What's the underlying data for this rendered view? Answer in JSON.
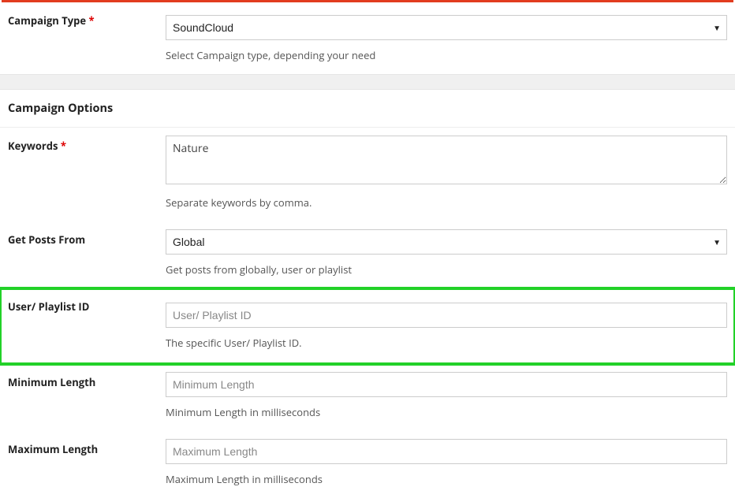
{
  "campaignType": {
    "label": "Campaign Type",
    "required": "*",
    "value": "SoundCloud",
    "help": "Select Campaign type, depending your need"
  },
  "optionsHeading": "Campaign Options",
  "keywords": {
    "label": "Keywords",
    "required": "*",
    "value": "Nature",
    "help": "Separate keywords by comma."
  },
  "getPostsFrom": {
    "label": "Get Posts From",
    "value": "Global",
    "help": "Get posts from globally, user or playlist"
  },
  "userPlaylist": {
    "label": "User/ Playlist ID",
    "placeholder": "User/ Playlist ID",
    "value": "",
    "help": "The specific User/ Playlist ID."
  },
  "minLength": {
    "label": "Minimum Length",
    "placeholder": "Minimum Length",
    "value": "",
    "help": "Minimum Length in milliseconds"
  },
  "maxLength": {
    "label": "Maximum Length",
    "placeholder": "Maximum Length",
    "value": "",
    "help": "Maximum Length in milliseconds"
  }
}
